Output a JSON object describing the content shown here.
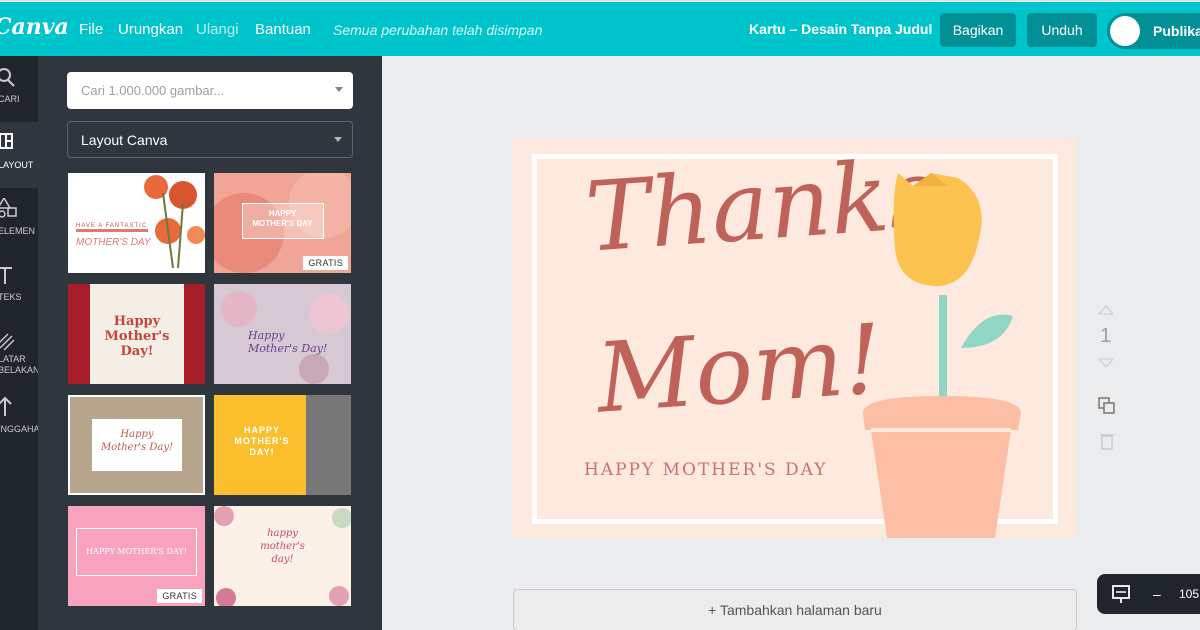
{
  "app": {
    "logo": "Canva"
  },
  "topbar": {
    "menu": [
      "File",
      "Urungkan",
      "Ulangi",
      "Bantuan"
    ],
    "saved_status": "Semua perubahan telah disimpan",
    "doc_title": "Kartu – Desain Tanpa Judul",
    "share_label": "Bagikan",
    "download_label": "Unduh",
    "publish_label": "Publikas"
  },
  "rail": {
    "items": [
      {
        "label": "CARI",
        "icon": "search-icon"
      },
      {
        "label": "LAYOUT",
        "icon": "layout-icon"
      },
      {
        "label": "ELEMEN",
        "icon": "elements-icon"
      },
      {
        "label": "TEKS",
        "icon": "text-icon"
      },
      {
        "label": "LATAR",
        "label2": "BELAKANG",
        "icon": "background-icon"
      },
      {
        "label": "UNGGAHAN",
        "icon": "upload-icon"
      }
    ]
  },
  "panel": {
    "search_placeholder": "Cari 1.000.000 gambar...",
    "layout_select": "Layout Canva",
    "thumbnails": [
      {
        "lines": [
          "HAVE A FANTASTIC",
          "MOTHER'S DAY"
        ],
        "badge": ""
      },
      {
        "lines": [
          "HAPPY",
          "MOTHER'S DAY"
        ],
        "badge": "GRATIS"
      },
      {
        "lines": [
          "Happy",
          "Mother's",
          "Day!"
        ],
        "badge": ""
      },
      {
        "lines": [
          "Happy",
          "Mother's Day!"
        ],
        "badge": ""
      },
      {
        "lines": [
          "Happy",
          "Mother's Day!"
        ],
        "badge": ""
      },
      {
        "lines": [
          "HAPPY",
          "MOTHER'S",
          "DAY!"
        ],
        "badge": ""
      },
      {
        "lines": [
          "HAPPY MOTHER'S DAY!"
        ],
        "badge": "GRATIS"
      },
      {
        "lines": [
          "happy",
          "mother's",
          "day!"
        ],
        "badge": ""
      }
    ]
  },
  "card": {
    "line1": "Thanks",
    "line2": "Mom!",
    "subtitle": "HAPPY MOTHER'S DAY"
  },
  "canvas": {
    "page_number": "1",
    "add_page": "+ Tambahkan halaman baru",
    "zoom": "105"
  },
  "colors": {
    "brand": "#00c4cc",
    "accent_dark": "#028f95",
    "card_text": "#bf625a",
    "card_bg": "#fde9de"
  }
}
